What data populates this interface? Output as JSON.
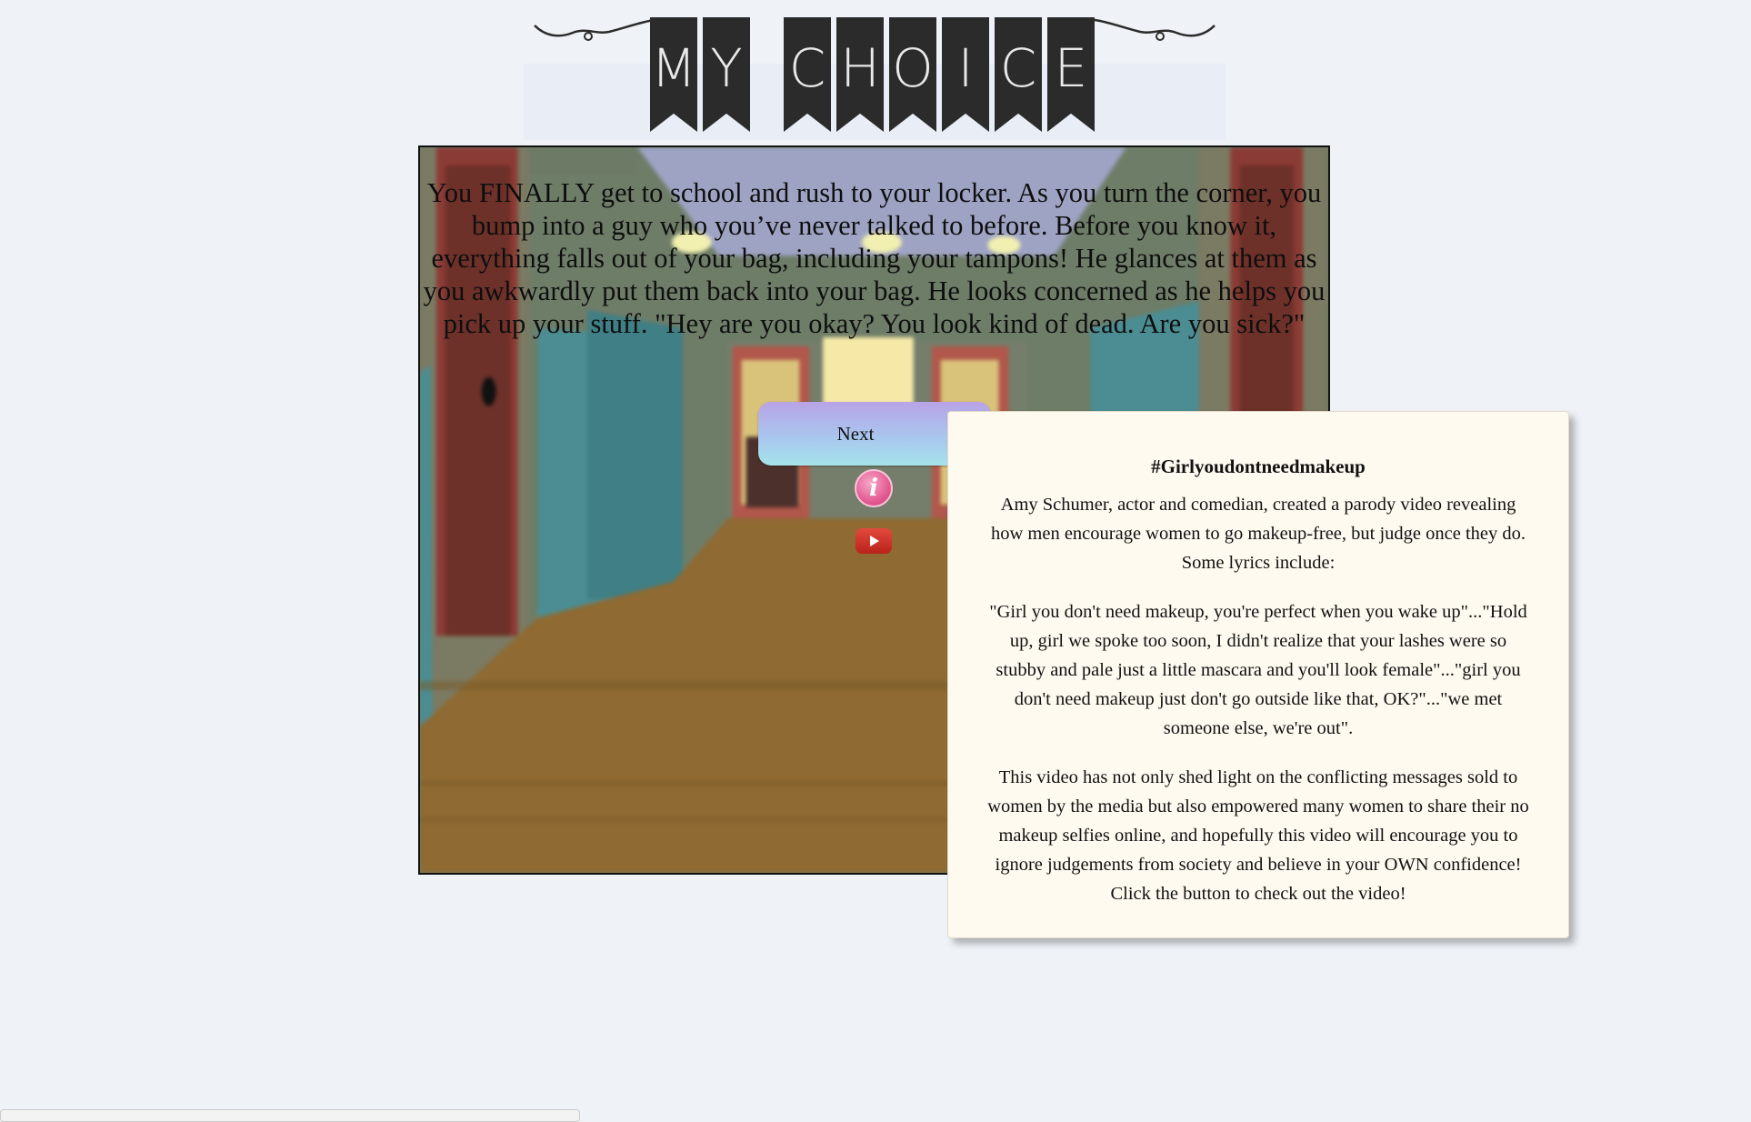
{
  "banner": {
    "letters": [
      "M",
      "Y",
      "C",
      "H",
      "O",
      "I",
      "C",
      "E"
    ]
  },
  "scene": {
    "story_text": "You FINALLY get to school and rush to your locker. As you turn the corner, you bump into a guy who you’ve never talked to before. Before you know it, everything falls out of your bag, including your tampons! He glances at them as you awkwardly put them back into your bag. He looks concerned as he helps you pick up your stuff. \"Hey are you okay? You look kind of dead. Are you sick?\"",
    "next_label": "Next",
    "info_icon_glyph": "i",
    "info_icon": "info-icon",
    "youtube_icon": "youtube-play-icon"
  },
  "popup": {
    "title": "#Girlyoudontneedmakeup",
    "para1": "Amy Schumer, actor and comedian, created a parody video revealing how men encourage women to go makeup-free, but judge once they do. Some lyrics include:",
    "para2": "\"Girl you don't need makeup, you're perfect when you wake up\"...\"Hold up, girl we spoke too soon, I didn't realize that your lashes were so stubby and pale just a little mascara and you'll look female\"...\"girl you don't need makeup just don't go outside like that, OK?\"...\"we met someone else, we're out\".",
    "para3": "This video has not only shed light on the conflicting messages sold to women by the media but also empowered many women to share their no makeup selfies online, and hopefully this video will encourage you to ignore judgements from society and believe in your OWN confidence! Click the button to check out the video!"
  },
  "colors": {
    "page_bg": "#eff3f8",
    "banner_flag": "#2b2b2b",
    "popup_bg": "#fefaf0",
    "next_gradient_top": "#b9a3e6",
    "next_gradient_bottom": "#a5e3ea",
    "info_pink": "#e45c93",
    "youtube_red": "#d2362b"
  }
}
